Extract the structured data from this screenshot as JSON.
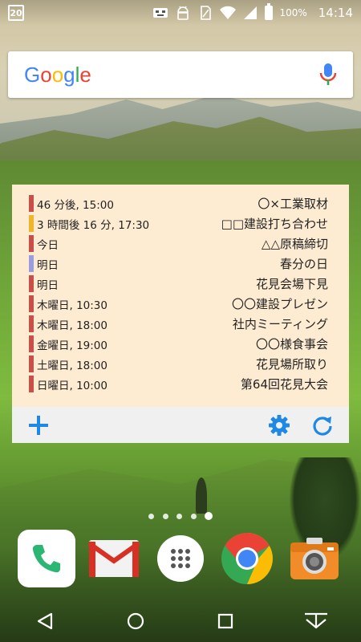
{
  "status_bar": {
    "calendar_day": "20",
    "battery_percent": "100%",
    "time": "14:14",
    "icons": [
      "calendar-icon",
      "notification-icon",
      "android-icon",
      "sim-icon",
      "wifi-icon",
      "signal-icon",
      "battery-icon"
    ]
  },
  "search": {
    "logo_letters": [
      {
        "char": "G",
        "color": "#4285F4"
      },
      {
        "char": "o",
        "color": "#EA4335"
      },
      {
        "char": "o",
        "color": "#FBBC05"
      },
      {
        "char": "g",
        "color": "#4285F4"
      },
      {
        "char": "l",
        "color": "#34A853"
      },
      {
        "char": "e",
        "color": "#EA4335"
      }
    ],
    "icons": [
      "google-logo",
      "mic-icon"
    ]
  },
  "widget": {
    "events": [
      {
        "time": "46 分後, 15:00",
        "title": "〇×工業取材",
        "color": "#c9504a"
      },
      {
        "time": "3 時間後 16 分, 17:30",
        "title": "□□建設打ち合わせ",
        "color": "#f0b52a"
      },
      {
        "time": "今日",
        "title": "△△原稿締切",
        "color": "#c9504a"
      },
      {
        "time": "明日",
        "title": "春分の日",
        "color": "#9b9de0"
      },
      {
        "time": "明日",
        "title": "花見会場下見",
        "color": "#c9504a"
      },
      {
        "time": "木曜日, 10:30",
        "title": "〇〇建設プレゼン",
        "color": "#c9504a"
      },
      {
        "time": "木曜日, 18:00",
        "title": "社内ミーティング",
        "color": "#c9504a"
      },
      {
        "time": "金曜日, 19:00",
        "title": "〇〇様食事会",
        "color": "#c9504a"
      },
      {
        "time": "土曜日, 18:00",
        "title": "花見場所取り",
        "color": "#c9504a"
      },
      {
        "time": "日曜日, 10:00",
        "title": "第64回花見大会",
        "color": "#c9504a"
      }
    ],
    "toolbar_icons": [
      "add-icon",
      "settings-icon",
      "refresh-icon"
    ],
    "accent_color": "#1e88e5"
  },
  "home": {
    "page_count": 5,
    "active_page": 5
  },
  "dock": {
    "apps": [
      "phone-app",
      "gmail-app",
      "app-drawer",
      "chrome-app",
      "camera-app"
    ]
  },
  "nav_bar": {
    "buttons": [
      "back-button",
      "home-button",
      "recents-button",
      "notification-pull-button"
    ]
  }
}
